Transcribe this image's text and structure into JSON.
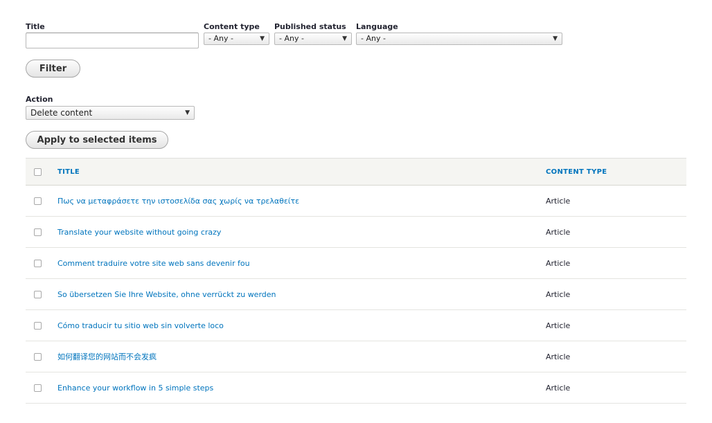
{
  "filters": {
    "title": {
      "label": "Title",
      "value": ""
    },
    "content_type": {
      "label": "Content type",
      "value": "- Any -"
    },
    "published_status": {
      "label": "Published status",
      "value": "- Any -"
    },
    "language": {
      "label": "Language",
      "value": "- Any -"
    },
    "filter_button": "Filter"
  },
  "action": {
    "label": "Action",
    "value": "Delete content",
    "apply_button": "Apply to selected items"
  },
  "table": {
    "headers": {
      "title": "TITLE",
      "content_type": "CONTENT TYPE"
    },
    "rows": [
      {
        "title": "Πως να μεταφράσετε την ιστοσελίδα σας χωρίς να τρελαθείτε",
        "type": "Article"
      },
      {
        "title": "Translate your website without going crazy",
        "type": "Article"
      },
      {
        "title": "Comment traduire votre site web sans devenir fou",
        "type": "Article"
      },
      {
        "title": "So übersetzen Sie Ihre Website, ohne verrückt zu werden",
        "type": "Article"
      },
      {
        "title": "Cómo traducir tu sitio web sin volverte loco",
        "type": "Article"
      },
      {
        "title": "如何翻译您的网站而不会发疯",
        "type": "Article"
      },
      {
        "title": "Enhance your workflow in 5 simple steps",
        "type": "Article"
      }
    ]
  },
  "icons": {
    "dropdown": "chevron-down-icon",
    "checkbox": "checkbox-icon"
  },
  "colors": {
    "link": "#0074bd",
    "header_bg": "#f5f5f2"
  }
}
